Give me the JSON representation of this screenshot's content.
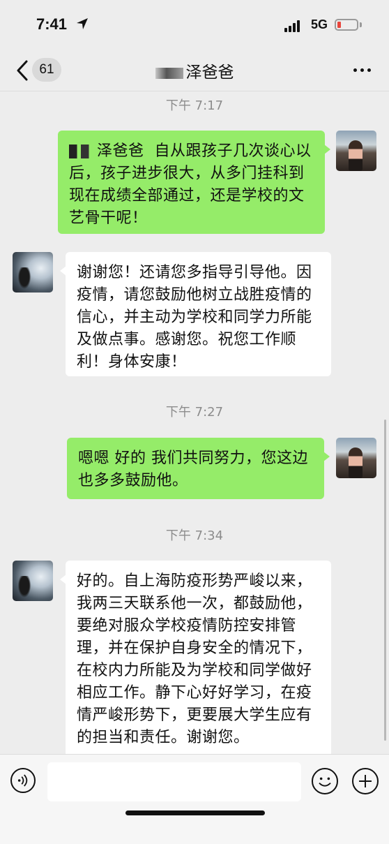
{
  "status_bar": {
    "time": "7:41",
    "network": "5G"
  },
  "nav": {
    "back_label": "<",
    "unread_count": "61",
    "title": "泽爸爸",
    "more_icon": "more-dots-icon"
  },
  "messages": [
    {
      "type": "timestamp",
      "text": "下午 7:17"
    },
    {
      "type": "sent",
      "redacted_prefix": true,
      "text": "泽爸爸  自从跟孩子几次谈心以后，孩子进步很大，从多门挂科到现在成绩全部通过，还是学校的文艺骨干呢！"
    },
    {
      "type": "received",
      "text": "谢谢您！还请您多指导引导他。因疫情，请您鼓励他树立战胜疫情的信心，并主动为学校和同学力所能及做点事。感谢您。祝您工作顺利！身体安康！"
    },
    {
      "type": "timestamp",
      "text": "下午 7:27"
    },
    {
      "type": "sent",
      "text": "嗯嗯 好的 我们共同努力，您这边也多多鼓励他。"
    },
    {
      "type": "timestamp",
      "text": "下午 7:34"
    },
    {
      "type": "received",
      "text": "好的。自上海防疫形势严峻以来，我两三天联系他一次，都鼓励他，要绝对服众学校疫情防控安排管理，并在保护自身安全的情况下，在校内力所能及为学校和同学做好相应工作。静下心好好学习，在疫情严峻形势下，更要展大学生应有的担当和责任。谢谢您。"
    }
  ],
  "input_bar": {
    "value": "",
    "voice_icon": "voice-icon",
    "emoji_icon": "emoji-icon",
    "plus_icon": "plus-icon"
  },
  "colors": {
    "sent_bubble": "#95ec69",
    "received_bubble": "#ffffff",
    "background": "#ededed",
    "battery_low": "#e8453c"
  }
}
